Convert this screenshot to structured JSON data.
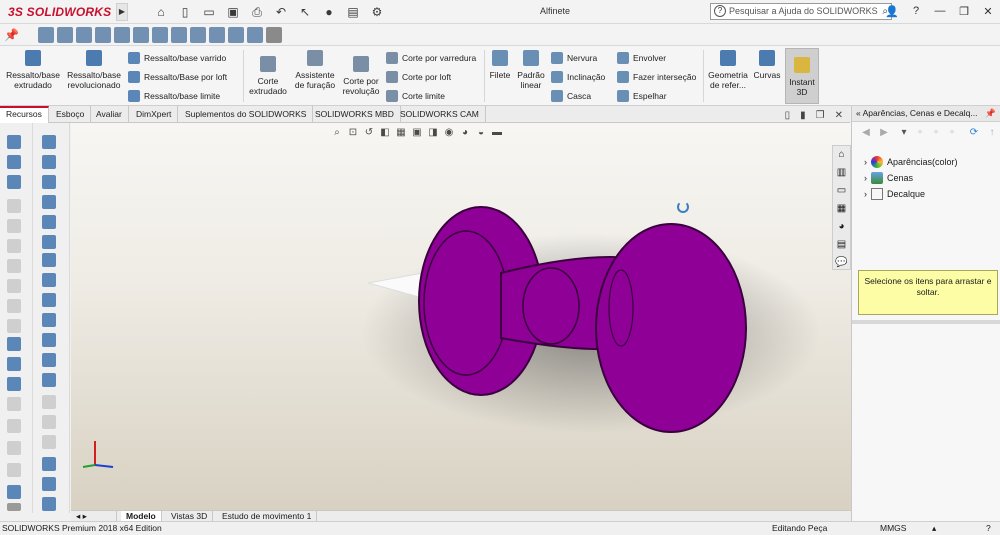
{
  "app": {
    "logo": "SOLIDWORKS",
    "logo_prefix": "3S",
    "document_title": "Alfinete",
    "search_placeholder": "Pesquisar a Ajuda do SOLIDWORKS"
  },
  "ribbon": {
    "features": [
      {
        "label": "Ressalto/base extrudado"
      },
      {
        "label": "Ressalto/base revolucionado"
      },
      {
        "label": "Ressalto/base varrido"
      },
      {
        "label": "Ressalto/Base por loft"
      },
      {
        "label": "Ressalto/base limite"
      },
      {
        "label": "Corte extrudado"
      },
      {
        "label": "Assistente de furação"
      },
      {
        "label": "Corte por revolução"
      },
      {
        "label": "Corte por varredura"
      },
      {
        "label": "Corte por loft"
      },
      {
        "label": "Corte limite"
      },
      {
        "label": "Filete"
      },
      {
        "label": "Padrão linear"
      },
      {
        "label": "Nervura"
      },
      {
        "label": "Inclinação"
      },
      {
        "label": "Casca"
      },
      {
        "label": "Envolver"
      },
      {
        "label": "Fazer interseção"
      },
      {
        "label": "Espelhar"
      },
      {
        "label": "Geometria de refer..."
      },
      {
        "label": "Curvas"
      },
      {
        "label": "Instant 3D"
      }
    ]
  },
  "tabs": [
    "Recursos",
    "Esboço",
    "Avaliar",
    "DimXpert",
    "Suplementos do SOLIDWORKS",
    "SOLIDWORKS MBD",
    "SOLIDWORKS CAM"
  ],
  "view_tabs": [
    "Modelo",
    "Vistas 3D",
    "Estudo de movimento 1"
  ],
  "right_panel": {
    "title": "Aparências, Cenas e Decalq...",
    "tree": [
      "Aparências(color)",
      "Cenas",
      "Decalque"
    ],
    "message": "Selecione os itens para arrastar e soltar."
  },
  "status": {
    "edition": "SOLIDWORKS Premium 2018 x64 Edition",
    "mode": "Editando Peça",
    "units": "MMGS"
  },
  "colors": {
    "part": "#8e0096",
    "brand": "#c8102e"
  }
}
